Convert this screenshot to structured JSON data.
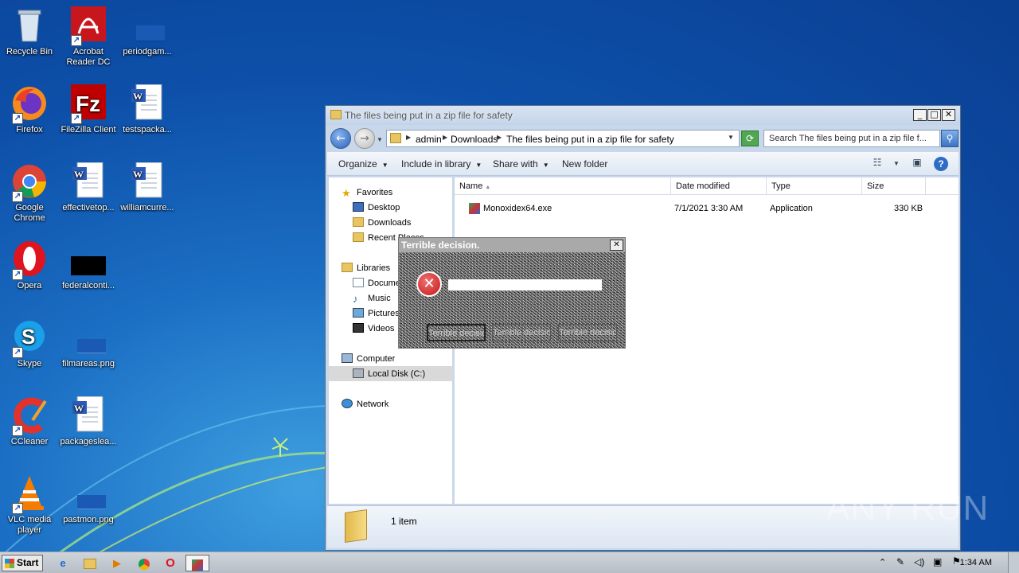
{
  "desktop": {
    "icons": [
      {
        "label": "Recycle Bin",
        "icon": "recycle-bin-icon"
      },
      {
        "label": "Acrobat\nReader DC",
        "icon": "acrobat-icon"
      },
      {
        "label": "periodgam...",
        "icon": "file-icon"
      },
      {
        "label": "Firefox",
        "icon": "firefox-icon"
      },
      {
        "label": "FileZilla Client",
        "icon": "filezilla-icon"
      },
      {
        "label": "testspacka...",
        "icon": "word-doc-icon"
      },
      {
        "label": "Google\nChrome",
        "icon": "chrome-icon"
      },
      {
        "label": "effectivetop...",
        "icon": "word-doc-icon"
      },
      {
        "label": "williamcurre...",
        "icon": "word-doc-icon"
      },
      {
        "label": "Opera",
        "icon": "opera-icon"
      },
      {
        "label": "federalconti...",
        "icon": "black-file-icon"
      },
      {
        "label": "Skype",
        "icon": "skype-icon"
      },
      {
        "label": "filmareas.png",
        "icon": "png-file-icon"
      },
      {
        "label": "CCleaner",
        "icon": "ccleaner-icon"
      },
      {
        "label": "packageslea...",
        "icon": "word-doc-icon"
      },
      {
        "label": "VLC media\nplayer",
        "icon": "vlc-icon"
      },
      {
        "label": "pastmon.png",
        "icon": "png-file-icon"
      }
    ]
  },
  "explorer": {
    "title": "The files being put in a zip file for safety",
    "breadcrumb": [
      "admin",
      "Downloads",
      "The files being put in a zip file for safety"
    ],
    "search_placeholder": "Search The files being put in a zip file f...",
    "toolbar": {
      "organize": "Organize",
      "include": "Include in library",
      "share": "Share with",
      "new_folder": "New folder"
    },
    "nav": {
      "favorites": "Favorites",
      "desktop": "Desktop",
      "downloads": "Downloads",
      "recent": "Recent Places",
      "libraries": "Libraries",
      "documents": "Documents",
      "music": "Music",
      "pictures": "Pictures",
      "videos": "Videos",
      "computer": "Computer",
      "local_disk": "Local Disk (C:)",
      "network": "Network"
    },
    "columns": {
      "name": "Name",
      "date": "Date modified",
      "type": "Type",
      "size": "Size"
    },
    "file": {
      "name": "Monoxidex64.exe",
      "date": "7/1/2021 3:30 AM",
      "type": "Application",
      "size": "330 KB"
    },
    "status": "1 item"
  },
  "dialog": {
    "title": "Terrible decision.",
    "buttons": [
      "Terrible decision",
      "Terrible decision",
      "Terrible decision"
    ]
  },
  "taskbar": {
    "start": "Start",
    "clock": "1:34 AM"
  },
  "watermark": "ANY RUN",
  "colors": {
    "accent": "#1b6fc4",
    "error": "#c41818"
  }
}
